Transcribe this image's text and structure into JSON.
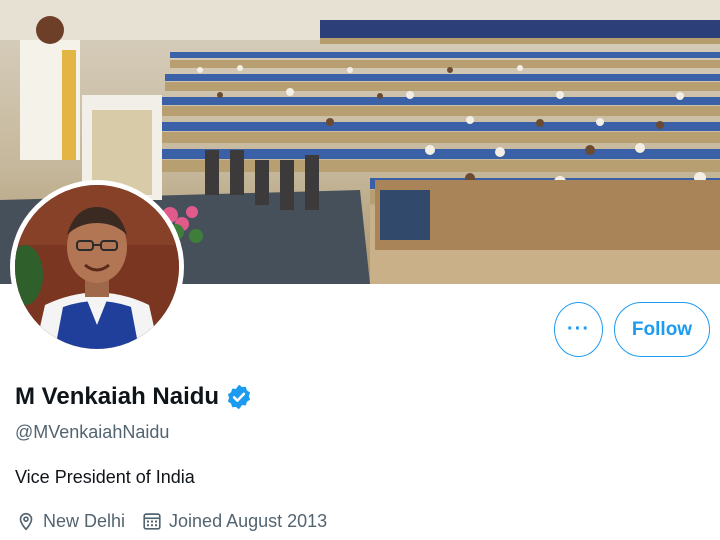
{
  "profile": {
    "display_name": "M Venkaiah Naidu",
    "handle": "@MVenkaiahNaidu",
    "bio": "Vice President of India",
    "location": "New Delhi",
    "joined": "Joined August 2013",
    "verified": true
  },
  "actions": {
    "more_label": "···",
    "follow_label": "Follow"
  },
  "colors": {
    "accent": "#1d9bf0",
    "muted_text": "#536471",
    "primary_text": "#0f1419"
  },
  "icons": {
    "verified": "verified-badge-icon",
    "location": "location-pin-icon",
    "calendar": "calendar-icon"
  }
}
